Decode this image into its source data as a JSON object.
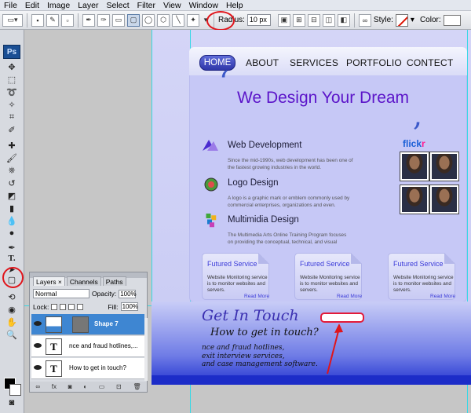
{
  "menu": [
    "File",
    "Edit",
    "Image",
    "Layer",
    "Select",
    "Filter",
    "View",
    "Window",
    "Help"
  ],
  "options_bar": {
    "radius_label": "Radius:",
    "radius_value": "10 px",
    "style_label": "Style:",
    "color_label": "Color:"
  },
  "tools": {
    "logo": "Ps"
  },
  "website": {
    "nav": [
      "HOME",
      "ABOUT",
      "SERVICES",
      "PORTFOLIO",
      "CONTECT"
    ],
    "headline": "We Design Your Dream",
    "services": [
      {
        "title": "Web Development",
        "desc": "Since the mid-1990s, web development has been one of the fastest growing industries in the world.",
        "icon_color": "#4a2bd0"
      },
      {
        "title": "Logo Design",
        "desc": "A logo is a graphic mark or emblem commonly used by commercial enterprises, organizations and even.",
        "icon_color": "#4a9a3a"
      },
      {
        "title": "Multimidia Design",
        "desc": "The Multimedia Arts Online Training Program focuses on providing the conceptual, technical, and visual",
        "icon_color": "#c73fb7"
      }
    ],
    "flickr_label": [
      "flick",
      "r"
    ],
    "cards": [
      {
        "title": "Futured Service",
        "text": "Website Monitoring service is to monitor websites and servers.",
        "more": "Read More"
      },
      {
        "title": "Futured Service",
        "text": "Website Monitoring service is to monitor websites and servers.",
        "more": "Read More"
      },
      {
        "title": "Futured Service",
        "text": "Website Monitoring service is to monitor websites and servers.",
        "more": "Read More"
      }
    ],
    "touch_title": "Get In Touch",
    "touch_sub": "How to get in touch?",
    "touch_lines": [
      "nce and fraud hotlines,",
      "exit interview services,",
      "and case management software."
    ]
  },
  "layers_panel": {
    "tabs": [
      "Layers",
      "Channels",
      "Paths"
    ],
    "blend_mode": "Normal",
    "opacity_label": "Opacity:",
    "opacity_value": "100%",
    "lock_label": "Lock:",
    "fill_label": "Fill:",
    "fill_value": "100%",
    "layers": [
      {
        "name": "Shape 7",
        "thumb": "",
        "selected": true
      },
      {
        "name": "nce and fraud hotlines,...",
        "thumb": "T",
        "selected": false
      },
      {
        "name": "How to get in touch?",
        "thumb": "T",
        "selected": false
      }
    ]
  },
  "colors": {
    "highlight": "#e0151b",
    "accent_purple": "#5b14c9",
    "nav_home": "#2f36a8",
    "layer_selected": "#3e86d2"
  }
}
